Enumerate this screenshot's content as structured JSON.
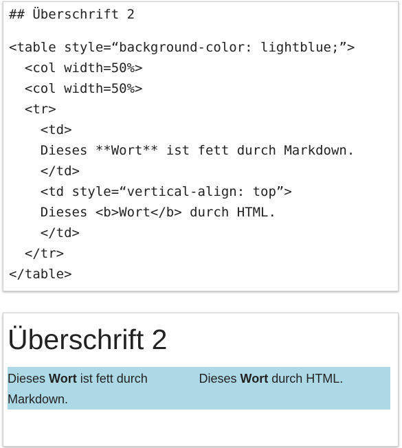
{
  "source_editor": {
    "lines": [
      "## Überschrift 2",
      "<table style=“background-color: lightblue;”>",
      "  <col width=50%>",
      "  <col width=50%>",
      "  <tr>",
      "    <td>",
      "    Dieses **Wort** ist fett durch Markdown.",
      "    </td>",
      "    <td style=“vertical-align: top”>",
      "    Dieses <b>Wort</b> durch HTML.",
      "    </td>",
      "  </tr>",
      "</table>"
    ]
  },
  "preview": {
    "heading": "Überschrift 2",
    "table_background": "#add8e6",
    "cell_1": {
      "prefix": "Dieses ",
      "bold": "Wort",
      "suffix": " ist fett durch Markdown."
    },
    "cell_2": {
      "prefix": "Dieses ",
      "bold": "Wort",
      "suffix": " durch HTML."
    }
  }
}
